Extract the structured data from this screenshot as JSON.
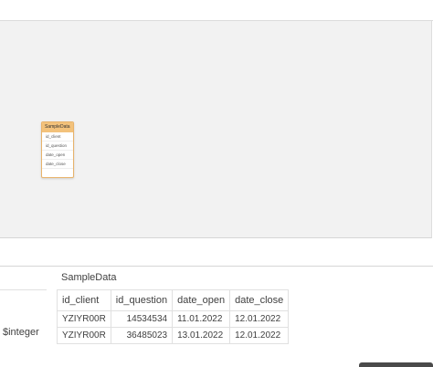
{
  "model": {
    "table_name": "SampleData",
    "fields": [
      "id_client",
      "id_question",
      "date_open",
      "date_close"
    ]
  },
  "side_panel": {
    "type_label": "$integer"
  },
  "preview": {
    "title": "SampleData",
    "columns": [
      "id_client",
      "id_question",
      "date_open",
      "date_close"
    ],
    "rows": [
      [
        "YZIYR00R",
        "14534534",
        "11.01.2022",
        "12.01.2022"
      ],
      [
        "YZIYR00R",
        "36485023",
        "13.01.2022",
        "12.01.2022"
      ]
    ]
  },
  "colors": {
    "table_header": "#f3c27b",
    "table_border": "#e8b36b",
    "canvas_bg": "#f2f2f2"
  }
}
